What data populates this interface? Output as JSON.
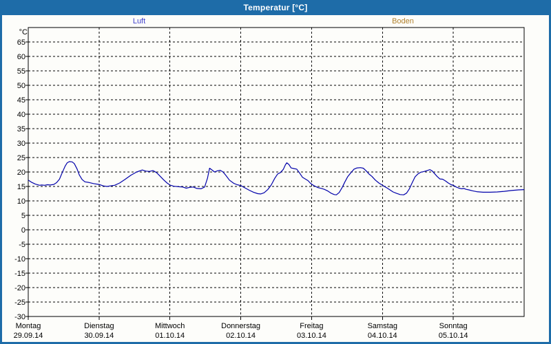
{
  "window": {
    "title": "Temperatur [°C]",
    "frame_color": "#1e6ca8",
    "content_background": "#fdfdfa"
  },
  "legend": {
    "items": [
      {
        "label": "Luft",
        "color": "#4040cc"
      },
      {
        "label": "Boden",
        "color": "#b0802c"
      }
    ]
  },
  "chart_data": {
    "type": "line",
    "title": "Temperatur [°C]",
    "y_unit": "°C",
    "ylim": [
      -30,
      70
    ],
    "y_frame_top": 70,
    "y_tick_step": 5,
    "y_tick_labels": [
      65,
      60,
      55,
      50,
      45,
      40,
      35,
      30,
      25,
      20,
      15,
      10,
      5,
      0,
      -5,
      -10,
      -15,
      -20,
      -25,
      -30
    ],
    "grid": "dashed",
    "legend_position": "top",
    "x_range_days": [
      0,
      7
    ],
    "x_axis_days": [
      {
        "name": "Montag",
        "date": "29.09.14"
      },
      {
        "name": "Dienstag",
        "date": "30.09.14"
      },
      {
        "name": "Mittwoch",
        "date": "01.10.14"
      },
      {
        "name": "Donnerstag",
        "date": "02.10.14"
      },
      {
        "name": "Freitag",
        "date": "03.10.14"
      },
      {
        "name": "Samstag",
        "date": "04.10.14"
      },
      {
        "name": "Sonntag",
        "date": "05.10.14"
      }
    ],
    "series": [
      {
        "name": "Luft",
        "color": "#0000aa",
        "points": [
          [
            0.0,
            17.2
          ],
          [
            0.05,
            16.4
          ],
          [
            0.1,
            15.8
          ],
          [
            0.16,
            15.4
          ],
          [
            0.19,
            15.5
          ],
          [
            0.23,
            15.4
          ],
          [
            0.27,
            15.6
          ],
          [
            0.31,
            15.5
          ],
          [
            0.36,
            15.7
          ],
          [
            0.4,
            16.3
          ],
          [
            0.44,
            17.5
          ],
          [
            0.48,
            19.8
          ],
          [
            0.52,
            22.0
          ],
          [
            0.55,
            23.2
          ],
          [
            0.58,
            23.6
          ],
          [
            0.62,
            23.5
          ],
          [
            0.65,
            22.9
          ],
          [
            0.69,
            21.0
          ],
          [
            0.72,
            19.0
          ],
          [
            0.76,
            17.4
          ],
          [
            0.8,
            16.6
          ],
          [
            0.85,
            16.4
          ],
          [
            0.92,
            16.0
          ],
          [
            1.0,
            15.7
          ],
          [
            1.06,
            15.2
          ],
          [
            1.11,
            15.0
          ],
          [
            1.16,
            15.2
          ],
          [
            1.22,
            15.4
          ],
          [
            1.29,
            16.2
          ],
          [
            1.37,
            17.5
          ],
          [
            1.45,
            18.9
          ],
          [
            1.53,
            20.0
          ],
          [
            1.61,
            20.7
          ],
          [
            1.66,
            20.3
          ],
          [
            1.71,
            20.2
          ],
          [
            1.76,
            20.5
          ],
          [
            1.81,
            19.8
          ],
          [
            1.86,
            18.6
          ],
          [
            1.91,
            17.3
          ],
          [
            1.96,
            16.2
          ],
          [
            2.0,
            15.5
          ],
          [
            2.05,
            15.1
          ],
          [
            2.12,
            14.9
          ],
          [
            2.18,
            14.8
          ],
          [
            2.23,
            14.4
          ],
          [
            2.28,
            14.7
          ],
          [
            2.33,
            14.8
          ],
          [
            2.38,
            14.3
          ],
          [
            2.44,
            14.2
          ],
          [
            2.49,
            14.8
          ],
          [
            2.53,
            17.8
          ],
          [
            2.56,
            21.3
          ],
          [
            2.6,
            20.6
          ],
          [
            2.63,
            20.0
          ],
          [
            2.67,
            20.4
          ],
          [
            2.71,
            20.6
          ],
          [
            2.75,
            20.0
          ],
          [
            2.79,
            18.8
          ],
          [
            2.84,
            17.2
          ],
          [
            2.9,
            16.1
          ],
          [
            2.95,
            15.6
          ],
          [
            3.0,
            15.3
          ],
          [
            3.06,
            14.5
          ],
          [
            3.12,
            13.7
          ],
          [
            3.18,
            13.0
          ],
          [
            3.24,
            12.5
          ],
          [
            3.28,
            12.4
          ],
          [
            3.33,
            12.8
          ],
          [
            3.38,
            13.9
          ],
          [
            3.43,
            15.5
          ],
          [
            3.48,
            17.8
          ],
          [
            3.52,
            19.3
          ],
          [
            3.56,
            19.8
          ],
          [
            3.6,
            20.9
          ],
          [
            3.63,
            22.5
          ],
          [
            3.65,
            23.2
          ],
          [
            3.68,
            22.6
          ],
          [
            3.71,
            21.4
          ],
          [
            3.75,
            21.2
          ],
          [
            3.79,
            21.0
          ],
          [
            3.83,
            19.7
          ],
          [
            3.87,
            18.2
          ],
          [
            3.91,
            17.6
          ],
          [
            3.95,
            17.0
          ],
          [
            3.98,
            16.2
          ],
          [
            4.0,
            15.8
          ],
          [
            4.04,
            15.2
          ],
          [
            4.09,
            14.6
          ],
          [
            4.14,
            14.3
          ],
          [
            4.18,
            14.0
          ],
          [
            4.23,
            13.4
          ],
          [
            4.28,
            12.6
          ],
          [
            4.32,
            12.2
          ],
          [
            4.35,
            12.1
          ],
          [
            4.39,
            12.9
          ],
          [
            4.43,
            14.6
          ],
          [
            4.47,
            16.6
          ],
          [
            4.51,
            18.4
          ],
          [
            4.56,
            19.9
          ],
          [
            4.6,
            21.0
          ],
          [
            4.64,
            21.4
          ],
          [
            4.69,
            21.5
          ],
          [
            4.73,
            21.3
          ],
          [
            4.77,
            20.4
          ],
          [
            4.81,
            19.3
          ],
          [
            4.85,
            18.5
          ],
          [
            4.9,
            17.2
          ],
          [
            4.95,
            16.2
          ],
          [
            5.0,
            15.4
          ],
          [
            5.05,
            14.7
          ],
          [
            5.1,
            13.9
          ],
          [
            5.15,
            13.1
          ],
          [
            5.2,
            12.6
          ],
          [
            5.25,
            12.2
          ],
          [
            5.3,
            12.1
          ],
          [
            5.34,
            12.7
          ],
          [
            5.38,
            14.2
          ],
          [
            5.42,
            16.3
          ],
          [
            5.46,
            18.3
          ],
          [
            5.5,
            19.3
          ],
          [
            5.54,
            19.9
          ],
          [
            5.59,
            20.2
          ],
          [
            5.63,
            20.5
          ],
          [
            5.67,
            20.8
          ],
          [
            5.7,
            20.4
          ],
          [
            5.73,
            19.6
          ],
          [
            5.77,
            18.5
          ],
          [
            5.81,
            17.6
          ],
          [
            5.85,
            17.5
          ],
          [
            5.89,
            16.9
          ],
          [
            5.93,
            16.2
          ],
          [
            5.97,
            15.6
          ],
          [
            6.0,
            15.4
          ],
          [
            6.04,
            14.8
          ],
          [
            6.08,
            14.4
          ],
          [
            6.12,
            14.2
          ],
          [
            6.15,
            14.3
          ],
          [
            6.18,
            14.0
          ],
          [
            6.22,
            13.8
          ],
          [
            6.27,
            13.5
          ],
          [
            6.33,
            13.2
          ],
          [
            6.42,
            13.0
          ],
          [
            6.52,
            13.0
          ],
          [
            6.62,
            13.1
          ],
          [
            6.72,
            13.3
          ],
          [
            6.82,
            13.6
          ],
          [
            6.92,
            13.8
          ],
          [
            7.0,
            13.9
          ]
        ]
      },
      {
        "name": "Boden",
        "color": "#b0802c",
        "points": []
      }
    ]
  }
}
